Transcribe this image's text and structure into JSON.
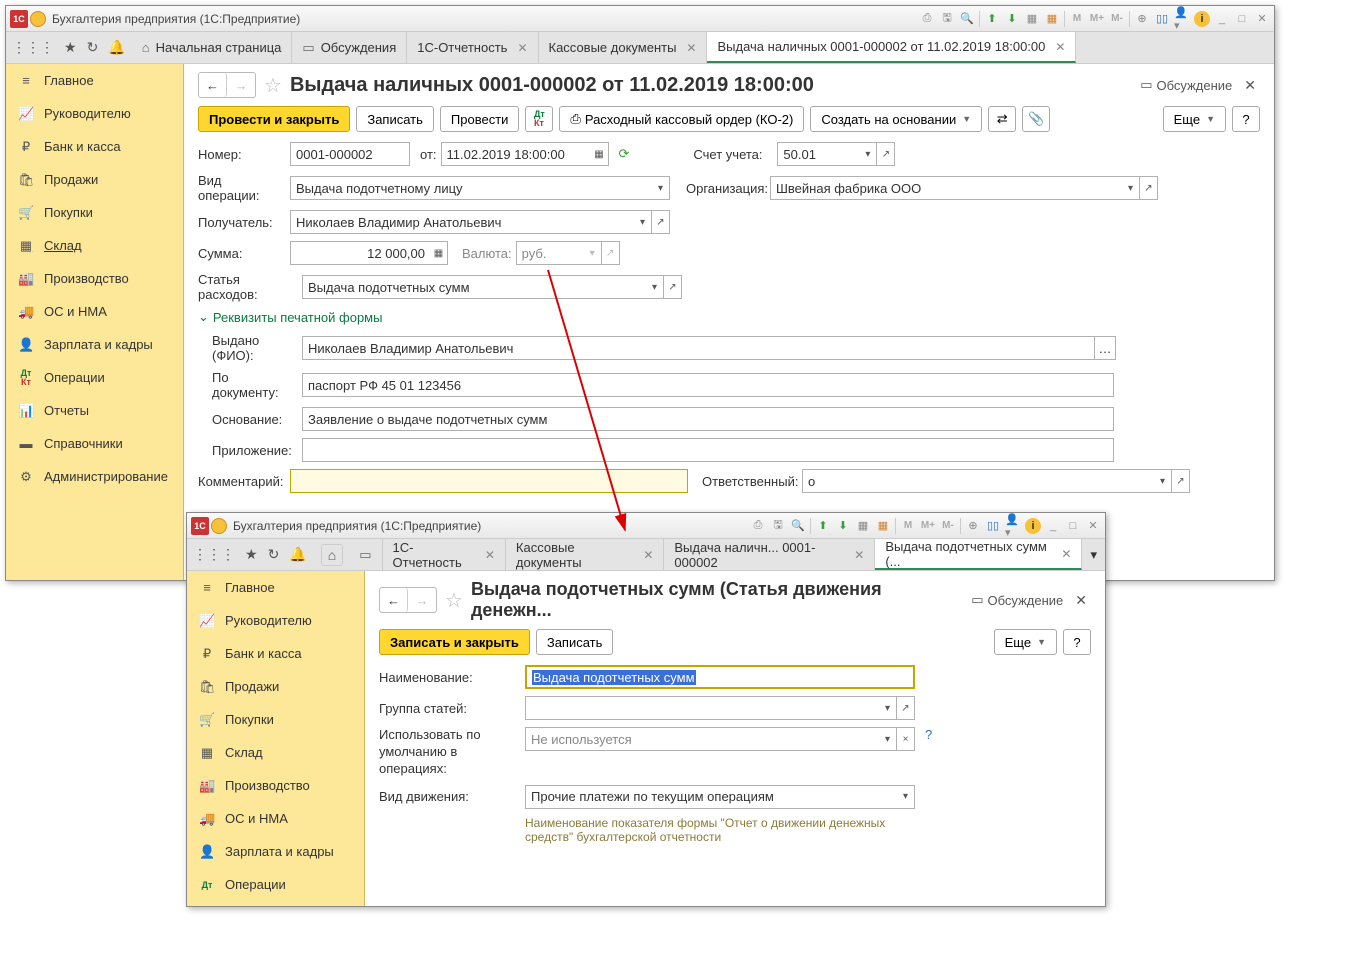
{
  "win1": {
    "title": "Бухгалтерия предприятия  (1С:Предприятие)",
    "tabs": {
      "home": "Начальная страница",
      "discuss": "Обсуждения",
      "reporting": "1С-Отчетность",
      "cashdocs": "Кассовые документы",
      "current": "Выдача наличных 0001-000002 от 11.02.2019 18:00:00"
    },
    "sidebar": [
      "Главное",
      "Руководителю",
      "Банк и касса",
      "Продажи",
      "Покупки",
      "Склад",
      "Производство",
      "ОС и НМА",
      "Зарплата и кадры",
      "Операции",
      "Отчеты",
      "Справочники",
      "Администрирование"
    ],
    "page": {
      "title": "Выдача наличных 0001-000002 от 11.02.2019 18:00:00",
      "discuss": "Обсуждение",
      "btn_post_close": "Провести и закрыть",
      "btn_save": "Записать",
      "btn_post": "Провести",
      "btn_print": "Расходный кассовый ордер (КО-2)",
      "btn_create_base": "Создать на основании",
      "btn_more": "Еще",
      "lbl_number": "Номер:",
      "val_number": "0001-000002",
      "lbl_from": "от:",
      "val_date": "11.02.2019 18:00:00",
      "lbl_account": "Счет учета:",
      "val_account": "50.01",
      "lbl_optype": "Вид операции:",
      "val_optype": "Выдача подотчетному лицу",
      "lbl_org": "Организация:",
      "val_org": "Швейная фабрика ООО",
      "lbl_recipient": "Получатель:",
      "val_recipient": "Николаев Владимир Анатольевич",
      "lbl_sum": "Сумма:",
      "val_sum": "12 000,00",
      "lbl_currency": "Валюта:",
      "val_currency": "руб.",
      "lbl_expense": "Статья расходов:",
      "val_expense": "Выдача подотчетных сумм",
      "section": "Реквизиты печатной формы",
      "lbl_issued": "Выдано (ФИО):",
      "val_issued": "Николаев Владимир Анатольевич",
      "lbl_bydoc": "По документу:",
      "val_bydoc": "паспорт РФ 45 01 123456",
      "lbl_basis": "Основание:",
      "val_basis": "Заявление о выдаче подотчетных сумм",
      "lbl_attach": "Приложение:",
      "lbl_comment": "Комментарий:",
      "lbl_responsible": "Ответственный:",
      "val_responsible": "о"
    }
  },
  "win2": {
    "title": "Бухгалтерия предприятия  (1С:Предприятие)",
    "tabs": {
      "reporting": "1С-Отчетность",
      "cashdocs": "Кассовые документы",
      "cash": "Выдача наличн... 0001-000002",
      "current": "Выдача подотчетных сумм (..."
    },
    "sidebar": [
      "Главное",
      "Руководителю",
      "Банк и касса",
      "Продажи",
      "Покупки",
      "Склад",
      "Производство",
      "ОС и НМА",
      "Зарплата и кадры",
      "Операции"
    ],
    "page": {
      "title": "Выдача подотчетных сумм (Статья движения денежн...",
      "discuss": "Обсуждение",
      "btn_save_close": "Записать и закрыть",
      "btn_save": "Записать",
      "btn_more": "Еще",
      "lbl_name": "Наименование:",
      "val_name": "Выдача подотчетных сумм",
      "lbl_group": "Группа статей:",
      "lbl_default": "Использовать по умолчанию в операциях:",
      "val_default": "Не используется",
      "lbl_movetype": "Вид движения:",
      "val_movetype": "Прочие платежи по текущим операциям",
      "hint": "Наименование показателя формы \"Отчет о движении денежных средств\" бухгалтерской отчетности"
    }
  }
}
